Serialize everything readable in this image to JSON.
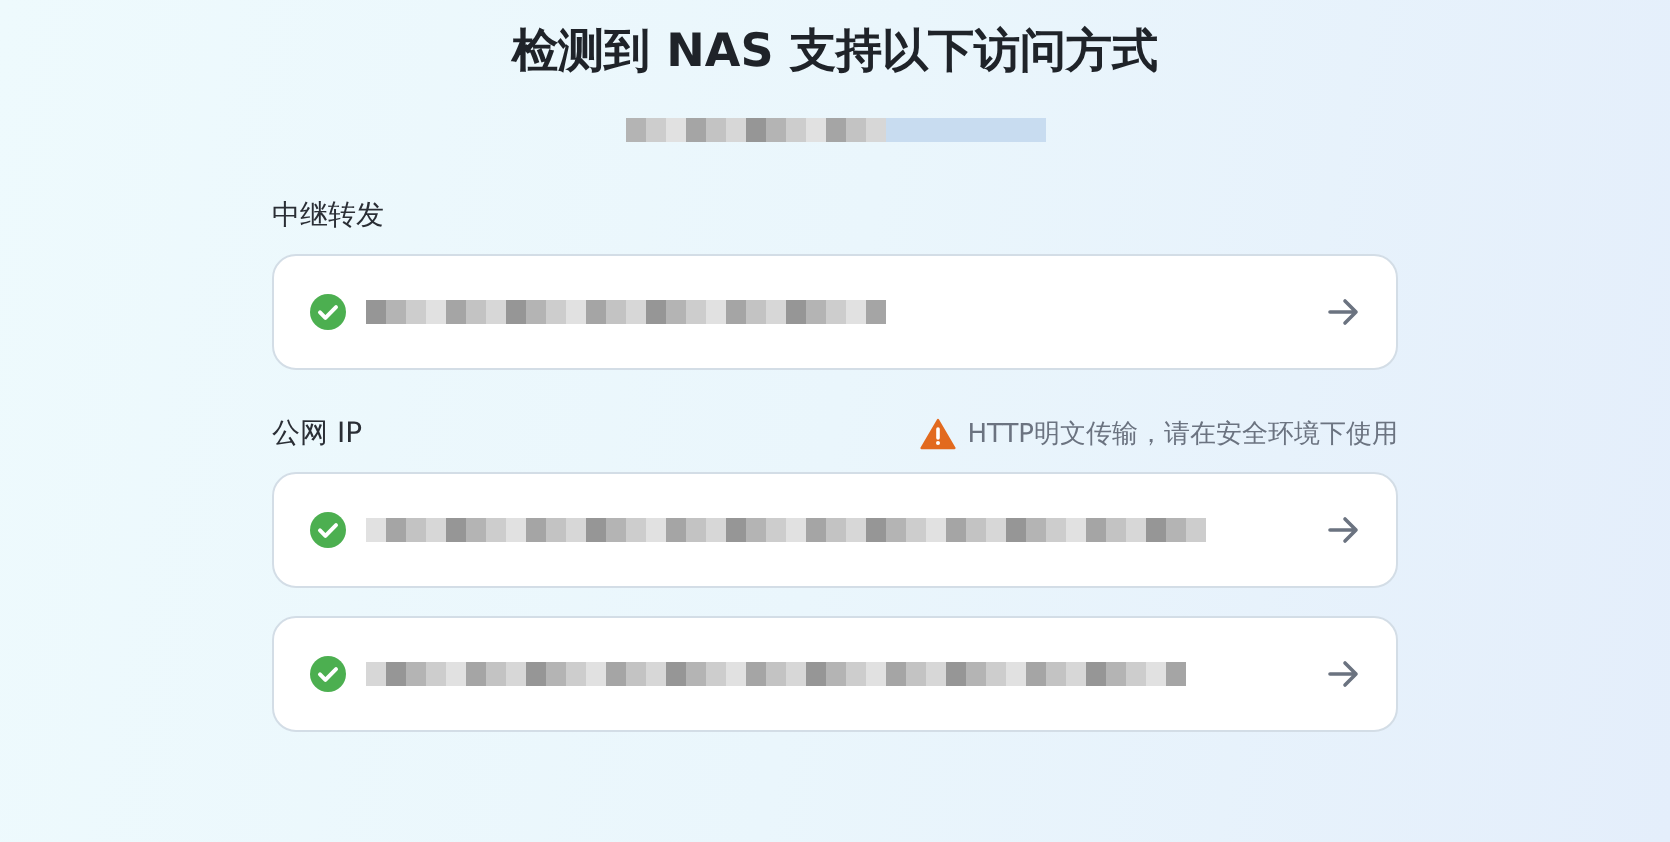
{
  "title": "检测到 NAS 支持以下访问方式",
  "sections": [
    {
      "label": "中继转发",
      "entries": [
        {
          "available": true
        }
      ]
    },
    {
      "label": "公网 IP",
      "warning": "HTTP明文传输，请在安全环境下使用",
      "entries": [
        {
          "available": true
        },
        {
          "available": true
        }
      ]
    }
  ]
}
